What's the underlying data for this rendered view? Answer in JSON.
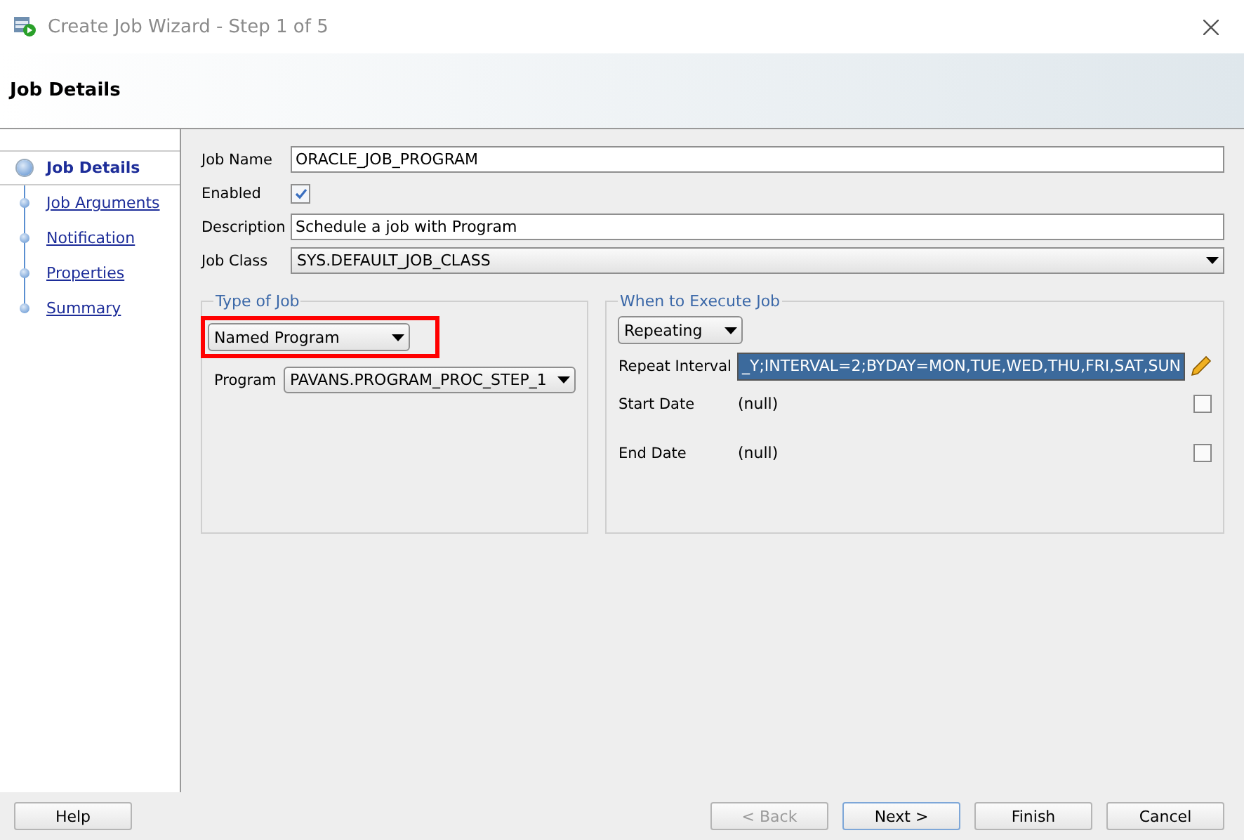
{
  "window": {
    "title": "Create Job Wizard - Step 1 of 5"
  },
  "header": {
    "title": "Job Details"
  },
  "steps": [
    {
      "label": "Job Details",
      "selected": true
    },
    {
      "label": "Job Arguments",
      "selected": false
    },
    {
      "label": "Notification",
      "selected": false
    },
    {
      "label": "Properties",
      "selected": false
    },
    {
      "label": "Summary",
      "selected": false
    }
  ],
  "form": {
    "job_name": {
      "label": "Job Name",
      "value": "ORACLE_JOB_PROGRAM"
    },
    "enabled": {
      "label": "Enabled",
      "checked": true
    },
    "description": {
      "label": "Description",
      "value": "Schedule a job with Program"
    },
    "job_class": {
      "label": "Job Class",
      "value": "SYS.DEFAULT_JOB_CLASS"
    }
  },
  "type_of_job": {
    "title": "Type of Job",
    "type": "Named Program",
    "highlighted": true,
    "program_label": "Program",
    "program": "PAVANS.PROGRAM_PROC_STEP_1"
  },
  "when_to_execute": {
    "title": "When to Execute Job",
    "mode": "Repeating",
    "repeat_label": "Repeat Interval",
    "repeat_value": "_Y;INTERVAL=2;BYDAY=MON,TUE,WED,THU,FRI,SAT,SUN",
    "dates": [
      {
        "label": "Start Date",
        "value": "(null)",
        "checked": false
      },
      {
        "label": "End Date",
        "value": "(null)",
        "checked": false
      }
    ]
  },
  "buttons": [
    {
      "label": "Help",
      "disabled": false,
      "default": false
    },
    {
      "label": "< Back",
      "disabled": true,
      "default": false
    },
    {
      "label": "Next >",
      "disabled": false,
      "default": true
    },
    {
      "label": "Finish",
      "disabled": false,
      "default": false
    },
    {
      "label": "Cancel",
      "disabled": false,
      "default": false
    }
  ]
}
